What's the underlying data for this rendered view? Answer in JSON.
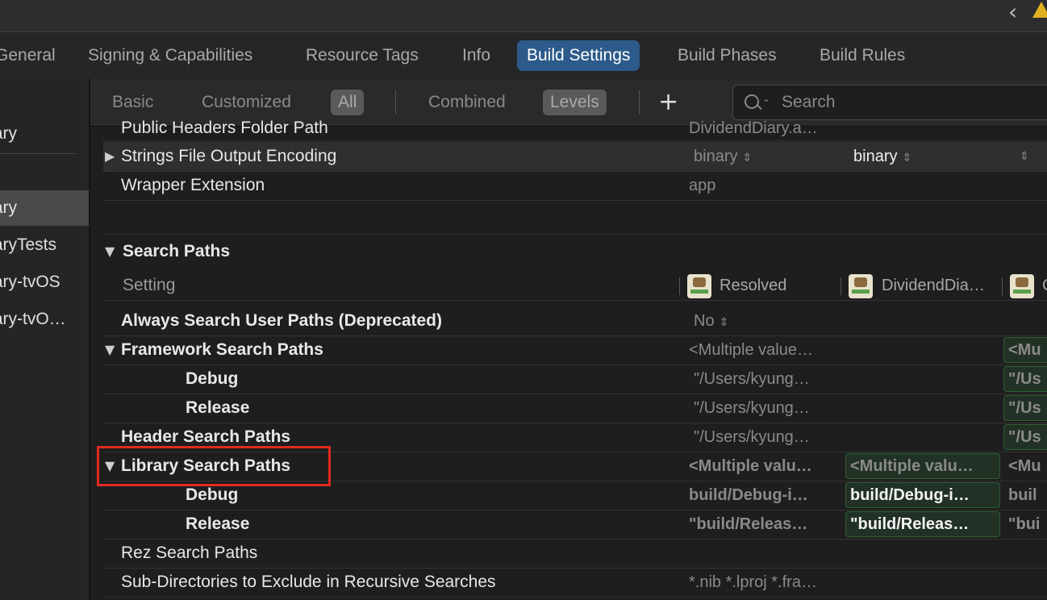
{
  "tabs": {
    "general": "General",
    "signing": "Signing & Capabilities",
    "resource_tags": "Resource Tags",
    "info": "Info",
    "build_settings": "Build Settings",
    "build_phases": "Build Phases",
    "build_rules": "Build Rules"
  },
  "sidebar": {
    "items": [
      "Diary",
      "Diary",
      "DiaryTests",
      "Diary-tvOS",
      "Diary-tvO…"
    ]
  },
  "filters": {
    "basic": "Basic",
    "customized": "Customized",
    "all": "All",
    "combined": "Combined",
    "levels": "Levels"
  },
  "search": {
    "placeholder": "Search"
  },
  "rows": {
    "public_headers": {
      "label": "Public Headers Folder Path",
      "value": "DividendDiary.a…"
    },
    "strings_encoding": {
      "label": "Strings File Output Encoding",
      "resolved": "binary",
      "target": "binary"
    },
    "wrapper_ext": {
      "label": "Wrapper Extension",
      "value": "app"
    }
  },
  "search_paths": {
    "title": "Search Paths",
    "setting_header": "Setting",
    "col_resolved": "Resolved",
    "col_target": "DividendDia…",
    "col_project": "C",
    "always_search": {
      "label": "Always Search User Paths (Deprecated)",
      "value": "No"
    },
    "framework": {
      "label": "Framework Search Paths",
      "value": "<Multiple value…",
      "project": "<Mu"
    },
    "framework_debug": {
      "label": "Debug",
      "value": "\"/Users/kyung…",
      "project": "\"/Us"
    },
    "framework_release": {
      "label": "Release",
      "value": "\"/Users/kyung…",
      "project": "\"/Us"
    },
    "header": {
      "label": "Header Search Paths",
      "value": "\"/Users/kyung…",
      "project": "\"/Us"
    },
    "library": {
      "label": "Library Search Paths",
      "value": "<Multiple valu…",
      "target": "<Multiple valu…",
      "project": "<Mu"
    },
    "library_debug": {
      "label": "Debug",
      "value": "build/Debug-i…",
      "target": "build/Debug-i…",
      "project": "buil"
    },
    "library_release": {
      "label": "Release",
      "value": "\"build/Releas…",
      "target": "\"build/Releas…",
      "project": "\"bui"
    },
    "rez": {
      "label": "Rez Search Paths"
    },
    "subdirs": {
      "label": "Sub-Directories to Exclude in Recursive Searches",
      "value": "*.nib *.lproj *.fra…"
    }
  },
  "colors": {
    "accent": "#2c5a8a",
    "highlight_box": "#e02a20",
    "green_border": "#2f5f34"
  }
}
